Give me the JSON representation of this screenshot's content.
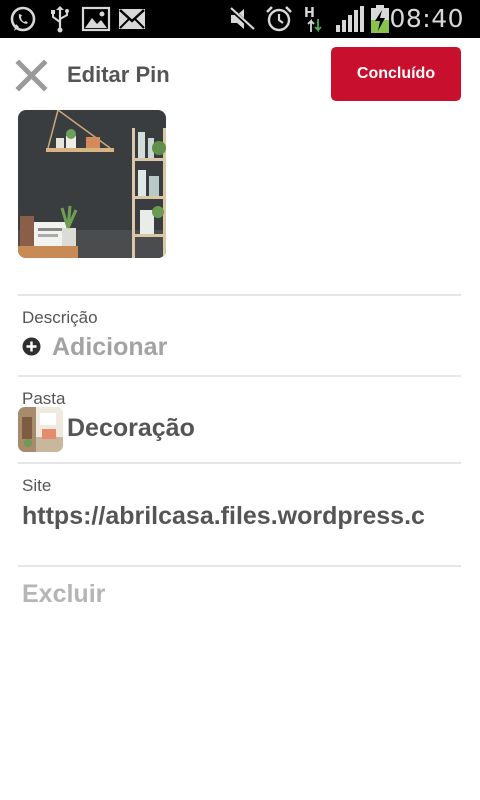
{
  "status_bar": {
    "time": "08:40",
    "network_type": "H",
    "icons": [
      "whatsapp-icon",
      "usb-icon",
      "gallery-icon",
      "email-icon",
      "mute-icon",
      "alarm-icon",
      "data-arrows-icon",
      "signal-icon",
      "battery-charging-icon"
    ]
  },
  "header": {
    "title": "Editar Pin",
    "done_label": "Concluído",
    "close_icon": "close-icon",
    "accent_color": "#c8102e"
  },
  "pin": {
    "image": "pin-thumbnail"
  },
  "description": {
    "label": "Descrição",
    "add_label": "Adicionar",
    "add_icon": "plus-circle-icon"
  },
  "board": {
    "label": "Pasta",
    "name": "Decoração"
  },
  "site": {
    "label": "Site",
    "value": "https://abrilcasa.files.wordpress.c"
  },
  "actions": {
    "delete_label": "Excluir"
  }
}
